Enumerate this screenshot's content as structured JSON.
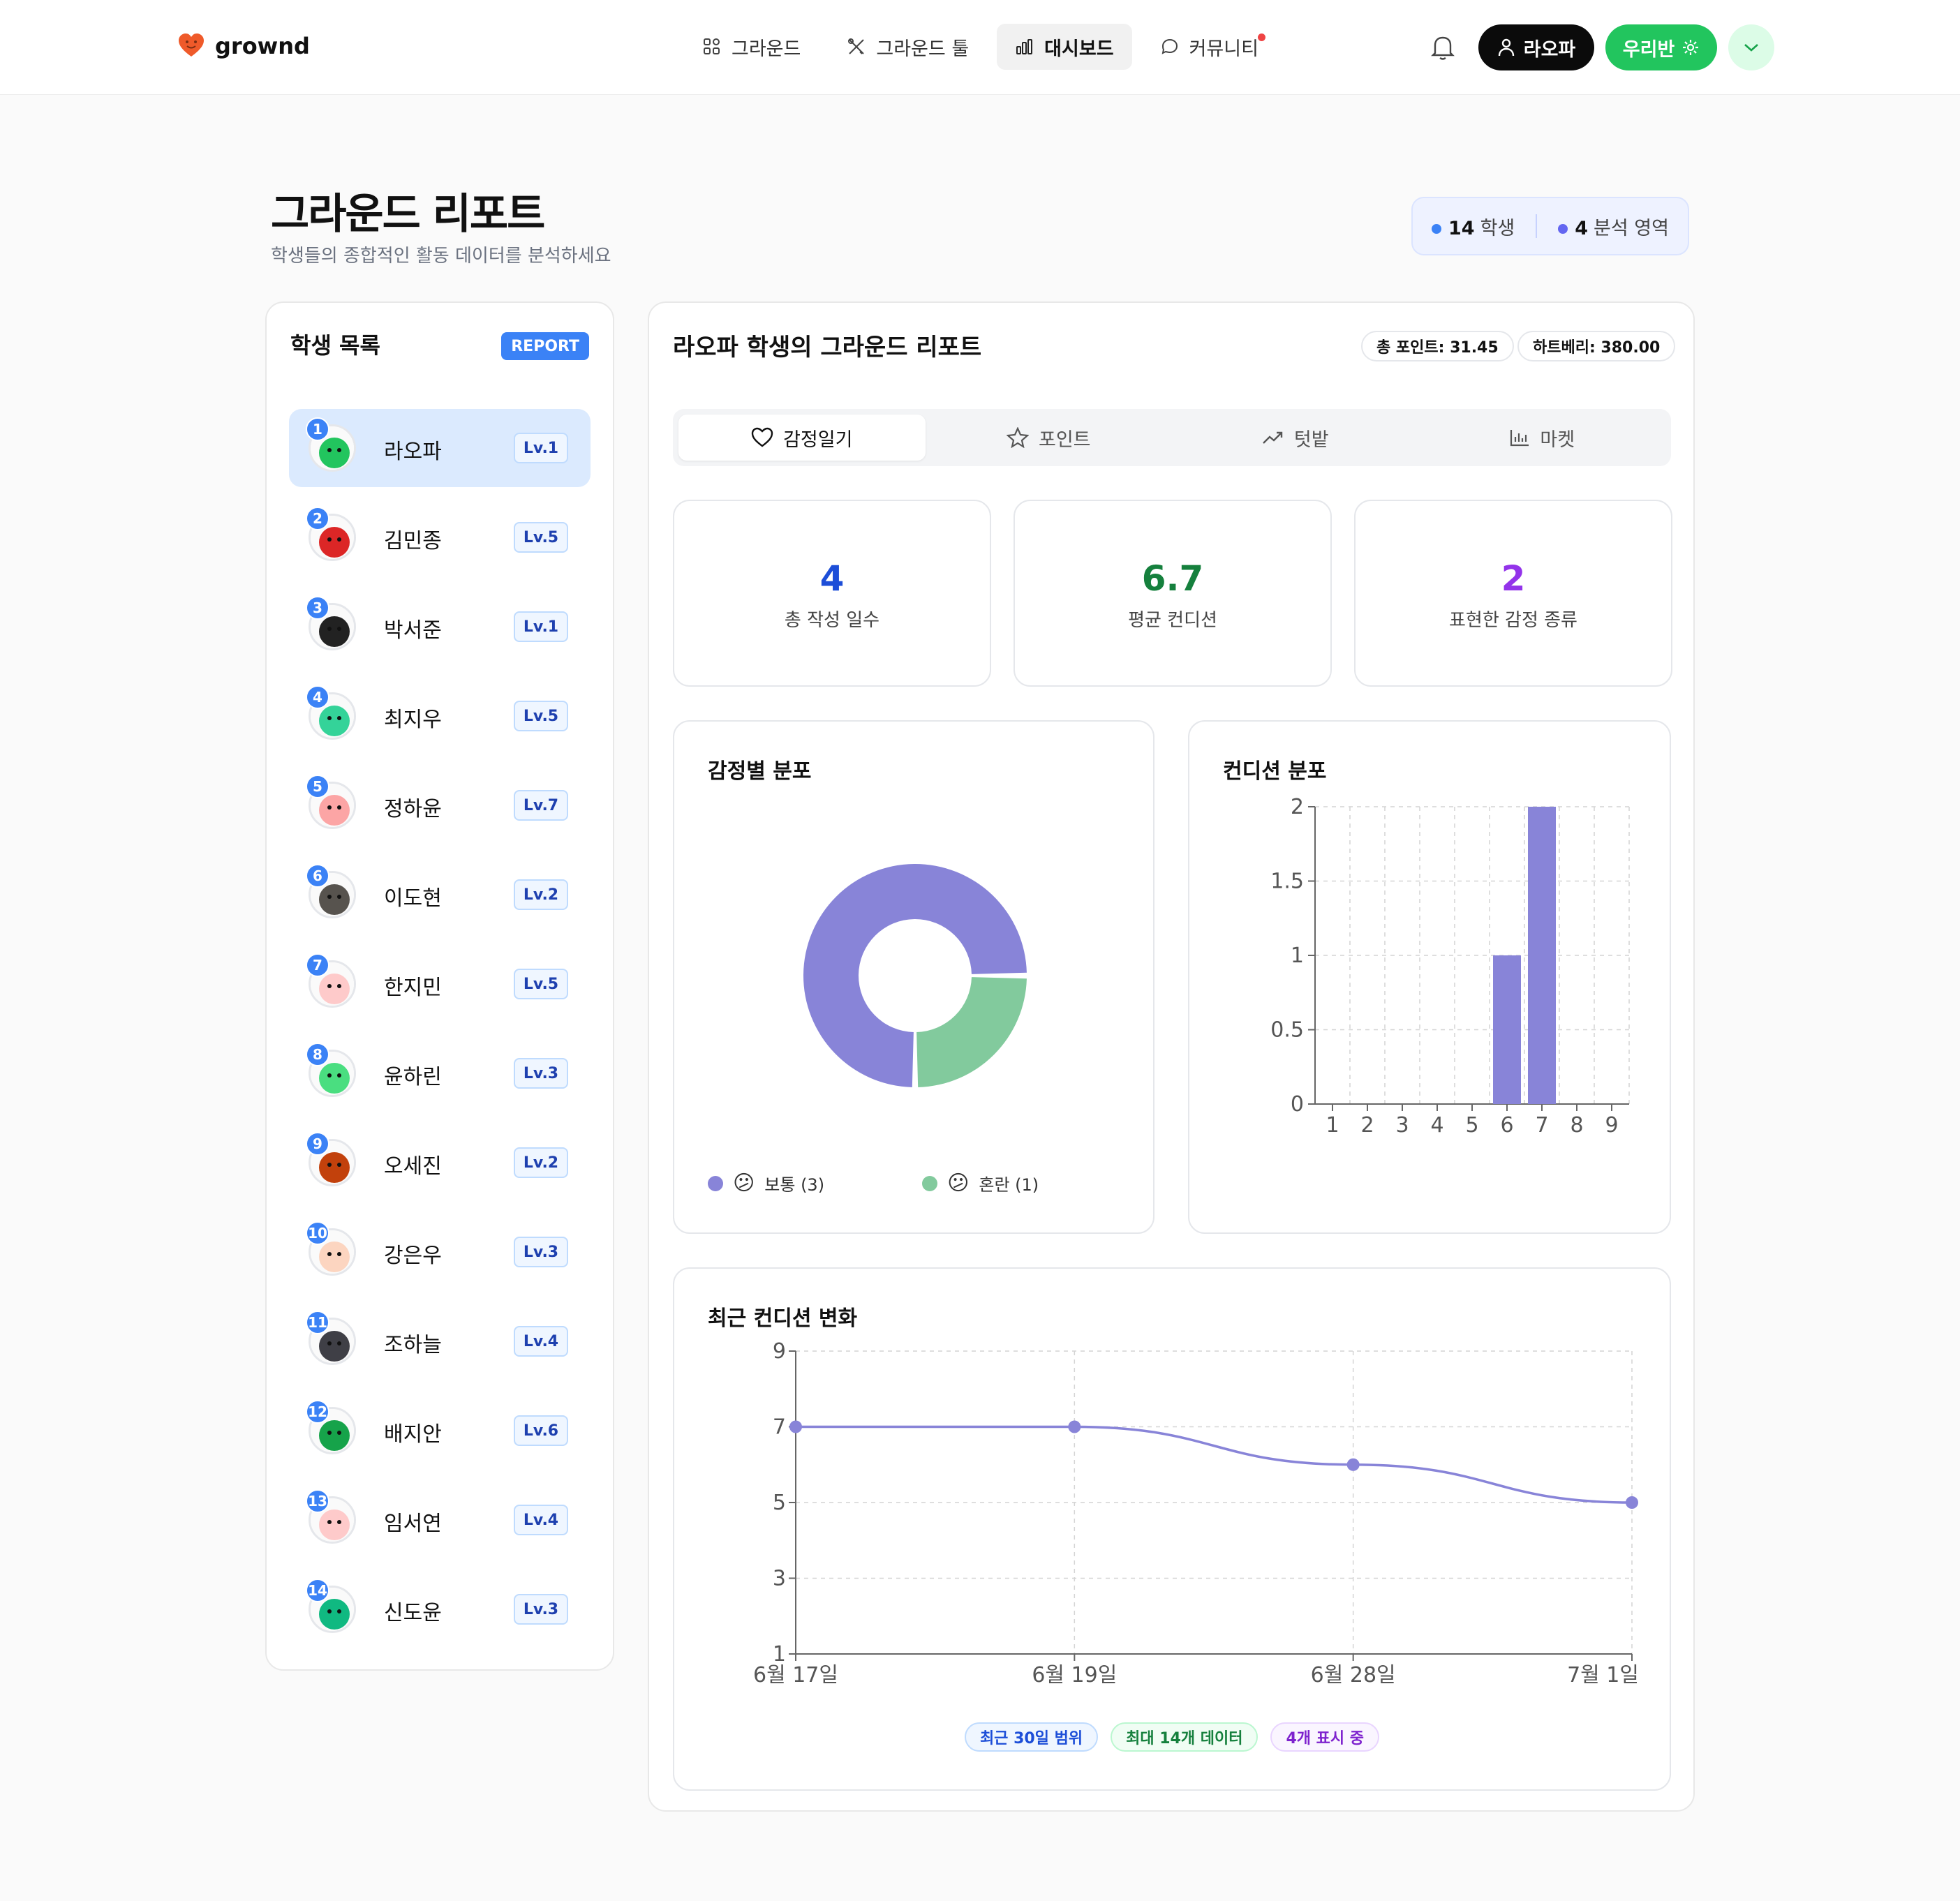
{
  "header": {
    "logo": "grownd",
    "nav": [
      {
        "label": "그라운드",
        "icon": "grid-icon"
      },
      {
        "label": "그라운드 툴",
        "icon": "tools-icon"
      },
      {
        "label": "대시보드",
        "icon": "bar-chart-icon"
      },
      {
        "label": "커뮤니티",
        "icon": "chat-bubble-icon"
      }
    ],
    "user_label": "라오파",
    "class_label": "우리반"
  },
  "page": {
    "title": "그라운드 리포트",
    "subtitle": "학생들의 종합적인 활동 데이터를 분석하세요",
    "students_count": "14",
    "students_unit": "학생",
    "areas_count": "4",
    "areas_unit": "분석 영역"
  },
  "students_panel": {
    "title": "학생 목록",
    "badge": "REPORT",
    "students": [
      {
        "num": "1",
        "name": "라오파",
        "level": "Lv.1",
        "color": "#22c55e"
      },
      {
        "num": "2",
        "name": "김민종",
        "level": "Lv.5",
        "color": "#dc2626"
      },
      {
        "num": "3",
        "name": "박서준",
        "level": "Lv.1",
        "color": "#222222"
      },
      {
        "num": "4",
        "name": "최지우",
        "level": "Lv.5",
        "color": "#34d399"
      },
      {
        "num": "5",
        "name": "정하윤",
        "level": "Lv.7",
        "color": "#fca5a5"
      },
      {
        "num": "6",
        "name": "이도현",
        "level": "Lv.2",
        "color": "#57534e"
      },
      {
        "num": "7",
        "name": "한지민",
        "level": "Lv.5",
        "color": "#fecaca"
      },
      {
        "num": "8",
        "name": "윤하린",
        "level": "Lv.3",
        "color": "#4ade80"
      },
      {
        "num": "9",
        "name": "오세진",
        "level": "Lv.2",
        "color": "#c2410c"
      },
      {
        "num": "10",
        "name": "강은우",
        "level": "Lv.3",
        "color": "#fcd5c0"
      },
      {
        "num": "11",
        "name": "조하늘",
        "level": "Lv.4",
        "color": "#3f3f46"
      },
      {
        "num": "12",
        "name": "배지안",
        "level": "Lv.6",
        "color": "#16a34a"
      },
      {
        "num": "13",
        "name": "임서연",
        "level": "Lv.4",
        "color": "#fecaca"
      },
      {
        "num": "14",
        "name": "신도윤",
        "level": "Lv.3",
        "color": "#10b981"
      }
    ]
  },
  "report": {
    "title": "라오파 학생의 그라운드 리포트",
    "total_points": "총 포인트: 31.45",
    "heartberry": "하트베리: 380.00",
    "tabs": [
      {
        "label": "감정일기",
        "icon": "heart-icon"
      },
      {
        "label": "포인트",
        "icon": "star-icon"
      },
      {
        "label": "텃밭",
        "icon": "trending-up-icon"
      },
      {
        "label": "마켓",
        "icon": "bar-chart-icon"
      }
    ],
    "stats": [
      {
        "value": "4",
        "label": "총 작성 일수",
        "color": "#1d4ed8"
      },
      {
        "value": "6.7",
        "label": "평균 컨디션",
        "color": "#15803d"
      },
      {
        "value": "2",
        "label": "표현한 감정 종류",
        "color": "#9333ea"
      }
    ],
    "chips": [
      {
        "label": "최근 30일 범위",
        "bg": "#eff6ff",
        "border": "#bfdbfe",
        "color": "#1d4ed8"
      },
      {
        "label": "최대 14개 데이터",
        "bg": "#f0fdf4",
        "border": "#bbf7d0",
        "color": "#15803d"
      },
      {
        "label": "4개 표시 중",
        "bg": "#faf5ff",
        "border": "#e9d5ff",
        "color": "#7e22ce"
      }
    ]
  },
  "chart_data": [
    {
      "type": "pie",
      "title": "감정별 분포",
      "donut": true,
      "slices": [
        {
          "label": "보통 (3)",
          "value": 3,
          "color": "#8884d8",
          "emoji": "😕"
        },
        {
          "label": "혼란 (1)",
          "value": 1,
          "color": "#82ca9d",
          "emoji": "😕"
        }
      ],
      "legend": "bottom"
    },
    {
      "type": "bar",
      "title": "컨디션 분포",
      "categories": [
        "1",
        "2",
        "3",
        "4",
        "5",
        "6",
        "7",
        "8",
        "9"
      ],
      "values": [
        0,
        0,
        0,
        0,
        0,
        1,
        2,
        0,
        0
      ],
      "ylim": [
        0,
        2
      ],
      "yticks": [
        "0",
        "0.5",
        "1",
        "1.5",
        "2"
      ],
      "color": "#8884d8",
      "grid": true
    },
    {
      "type": "line",
      "title": "최근 컨디션 변화",
      "x": [
        "6월 17일",
        "6월 19일",
        "6월 28일",
        "7월 1일"
      ],
      "values": [
        7,
        7,
        6,
        5
      ],
      "ylim": [
        1,
        9
      ],
      "yticks": [
        "1",
        "3",
        "5",
        "7",
        "9"
      ],
      "color": "#8884d8",
      "grid": true
    }
  ]
}
